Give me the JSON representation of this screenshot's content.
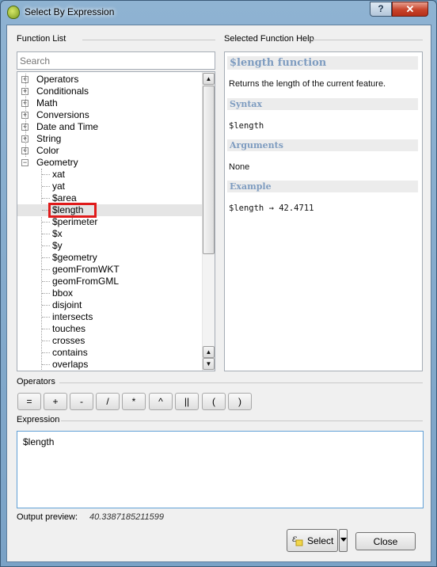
{
  "window": {
    "title": "Select By Expression",
    "help": "?",
    "close": "✕"
  },
  "function_list": {
    "label": "Function List",
    "search_placeholder": "Search",
    "groups": [
      {
        "label": "Operators",
        "expander": "+"
      },
      {
        "label": "Conditionals",
        "expander": "+"
      },
      {
        "label": "Math",
        "expander": "+"
      },
      {
        "label": "Conversions",
        "expander": "+"
      },
      {
        "label": "Date and Time",
        "expander": "+"
      },
      {
        "label": "String",
        "expander": "+"
      },
      {
        "label": "Color",
        "expander": "+"
      },
      {
        "label": "Geometry",
        "expander": "−"
      }
    ],
    "children": [
      "xat",
      "yat",
      "$area",
      "$length",
      "$perimeter",
      "$x",
      "$y",
      "$geometry",
      "geomFromWKT",
      "geomFromGML",
      "bbox",
      "disjoint",
      "intersects",
      "touches",
      "crosses",
      "contains",
      "overlaps"
    ],
    "selected": "$length"
  },
  "help": {
    "label": "Selected Function Help",
    "title": "$length function",
    "description": "Returns the length of the current feature.",
    "syntax_heading": "Syntax",
    "syntax": "$length",
    "arguments_heading": "Arguments",
    "arguments": "None",
    "example_heading": "Example",
    "example": "$length → 42.4711"
  },
  "operators": {
    "label": "Operators",
    "buttons": [
      "=",
      "+",
      "-",
      "/",
      "*",
      "^",
      "||",
      "(",
      ")"
    ]
  },
  "expression": {
    "label": "Expression",
    "value": "$length"
  },
  "preview": {
    "label": "Output preview:",
    "value": "40.3387185211599"
  },
  "actions": {
    "select": "Select",
    "close": "Close"
  },
  "colors": {
    "highlight": "#e01b1b",
    "help_heading": "#7e9cc0",
    "expression_border": "#61a0d6"
  }
}
